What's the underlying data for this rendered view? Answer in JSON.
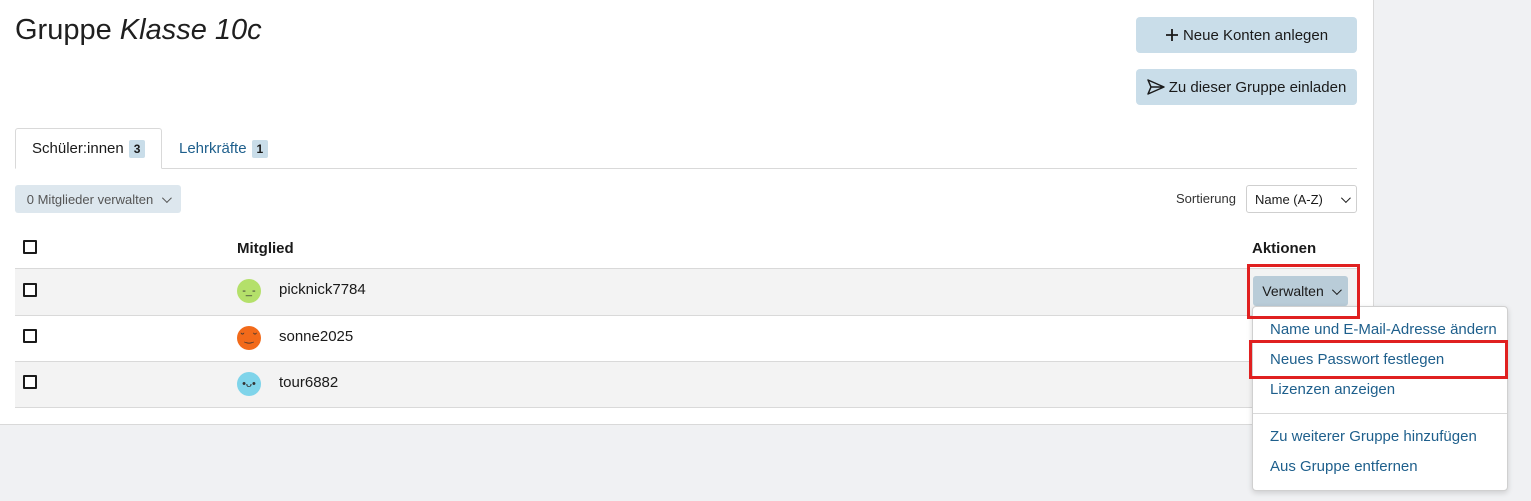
{
  "header": {
    "title_prefix": "Gruppe",
    "title_group": "Klasse 10c",
    "new_accounts_label": "Neue Konten anlegen",
    "invite_label": "Zu dieser Gruppe einladen"
  },
  "tabs": [
    {
      "label": "Schüler:innen",
      "count": "3"
    },
    {
      "label": "Lehrkräfte",
      "count": "1"
    }
  ],
  "toolbar": {
    "manage_members_label": "0 Mitglieder verwalten",
    "sort_label": "Sortierung",
    "sort_value": "Name (A-Z)"
  },
  "table": {
    "col_member": "Mitglied",
    "col_actions": "Aktionen",
    "rows": [
      {
        "name": "picknick7784",
        "avatar_color": "#b4e06a",
        "avatar_face": "-_-"
      },
      {
        "name": "sonne2025",
        "avatar_color": "#f26a1a",
        "avatar_face": "˘‿˘"
      },
      {
        "name": "tour6882",
        "avatar_color": "#7fd4ea",
        "avatar_face": "•ᴗ•"
      }
    ],
    "manage_button_label": "Verwalten"
  },
  "menu": {
    "items": [
      "Name und E-Mail-Adresse ändern",
      "Neues Passwort festlegen",
      "Lizenzen anzeigen",
      "Zu weiterer Gruppe hinzufügen",
      "Aus Gruppe entfernen"
    ]
  },
  "colors": {
    "accent_button": "#c9dde9",
    "link": "#1e5f8c",
    "highlight": "#e02020"
  }
}
